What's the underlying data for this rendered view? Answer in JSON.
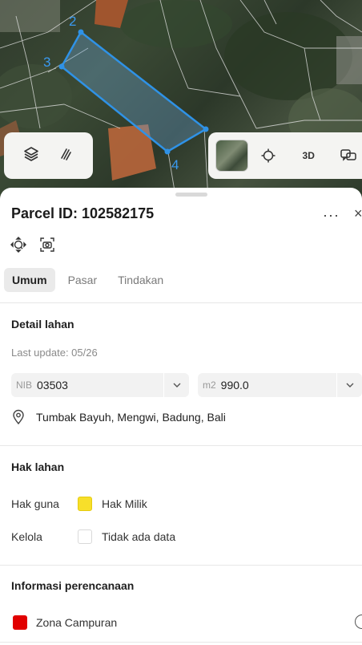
{
  "map": {
    "parcel_vertex_labels": [
      "2",
      "3",
      "4"
    ],
    "controls": {
      "layers_icon": "layers-icon",
      "draw_icon": "draw-icon",
      "basemap_thumbnail": "satellite-thumbnail",
      "locate_icon": "crosshair-icon",
      "label_3d": "3D",
      "chat_icon": "chat-icon"
    }
  },
  "sheet": {
    "title": "Parcel ID: 102582175",
    "more_label": "···",
    "close_label": "×",
    "tabs": [
      {
        "label": "Umum",
        "active": true
      },
      {
        "label": "Pasar",
        "active": false
      },
      {
        "label": "Tindakan",
        "active": false
      }
    ],
    "detail": {
      "title": "Detail lahan",
      "last_update": "Last update: 05/26",
      "nib_prefix": "NIB",
      "nib_value": "03503",
      "area_prefix": "m2",
      "area_value": "990.0",
      "location": "Tumbak Bayuh, Mengwi, Badung, Bali"
    },
    "rights": {
      "title": "Hak lahan",
      "hak_guna_label": "Hak guna",
      "hak_guna_value": "Hak Milik",
      "hak_guna_color": "#f7df2a",
      "kelola_label": "Kelola",
      "kelola_value": "Tidak ada data"
    },
    "planning": {
      "title": "Informasi perencanaan",
      "zone_label": "Zona Campuran",
      "zone_color": "#e10000"
    }
  }
}
